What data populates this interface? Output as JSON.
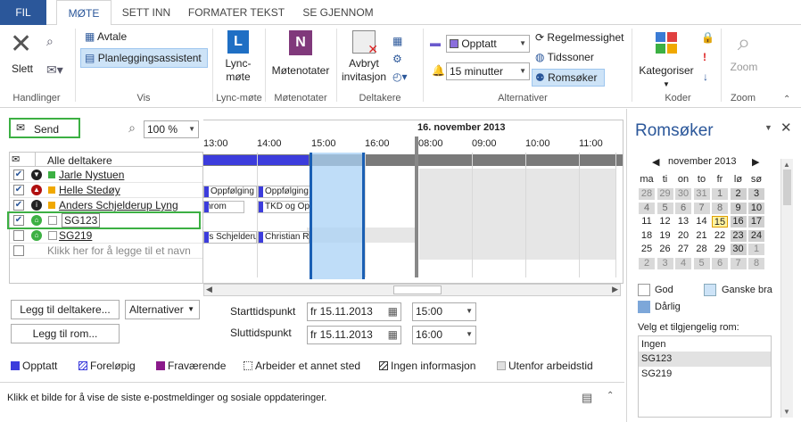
{
  "tabs": [
    {
      "label": "FIL"
    },
    {
      "label": "MØTE"
    },
    {
      "label": "SETT INN"
    },
    {
      "label": "FORMATER TEKST"
    },
    {
      "label": "SE GJENNOM"
    }
  ],
  "ribbon": {
    "slett": "Slett",
    "avtale": "Avtale",
    "planlegging": "Planleggingsassistent",
    "lync": "Lync-\nmøte",
    "motenotater": "Møtenotater",
    "avbryt1": "Avbryt",
    "avbryt2": "invitasjon",
    "status_combo": "Opptatt",
    "reminder_combo": "15 minutter",
    "regelmessighet": "Regelmessighet",
    "tidssoner": "Tidssoner",
    "romsoker": "Romsøker",
    "kategoriser": "Kategoriser",
    "zoom": "Zoom",
    "groups": [
      "Handlinger",
      "Vis",
      "Lync-møte",
      "Møtenotater",
      "Deltakere",
      "Alternativer",
      "Koder",
      "Zoom"
    ]
  },
  "toolbar": {
    "send": "Send",
    "zoom_value": "100 %"
  },
  "schedule": {
    "date": "16. november 2013",
    "times": [
      "13:00",
      "14:00",
      "15:00",
      "16:00",
      "08:00",
      "09:00",
      "10:00",
      "11:00"
    ],
    "all_attendees": "Alle deltakere",
    "attendees": [
      {
        "name": "Jarle Nystuen",
        "color": "#3cb043"
      },
      {
        "name": "Helle Stedøy",
        "color": "#f0a800"
      },
      {
        "name": "Anders Schjelderup Lyng",
        "color": "#f0a800"
      },
      {
        "name": "SG123",
        "color": ""
      },
      {
        "name": "SG219",
        "color": ""
      }
    ],
    "add_placeholder": "Klikk her for å legge til et navn",
    "busy": {
      "helle_a": "Oppfølging a",
      "helle_b": "Oppfølging a",
      "anders_a": "nrom",
      "anders_b": "TKD og Oper",
      "sg219_a": "rs Schjelderup L",
      "sg219_b": "Christian Ran"
    }
  },
  "buttons": {
    "legg_deltakere": "Legg til deltakere...",
    "alternativer": "Alternativer",
    "legg_rom": "Legg til rom..."
  },
  "times": {
    "start_label": "Starttidspunkt",
    "end_label": "Sluttidspunkt",
    "start_date": "fr 15.11.2013",
    "start_time": "15:00",
    "end_date": "fr 15.11.2013",
    "end_time": "16:00"
  },
  "legend": [
    "Opptatt",
    "Foreløpig",
    "Fraværende",
    "Arbeider et annet sted",
    "Ingen informasjon",
    "Utenfor arbeidstid"
  ],
  "status_bar": "Klikk et bilde for å vise de siste e-postmeldinger og sosiale oppdateringer.",
  "room_finder": {
    "title": "Romsøker",
    "month": "november 2013",
    "weekdays": [
      "ma",
      "ti",
      "on",
      "to",
      "fr",
      "lø",
      "sø"
    ],
    "weeks": [
      [
        "28",
        "29",
        "30",
        "31",
        "1",
        "2",
        "3"
      ],
      [
        "4",
        "5",
        "6",
        "7",
        "8",
        "9",
        "10"
      ],
      [
        "11",
        "12",
        "13",
        "14",
        "15",
        "16",
        "17"
      ],
      [
        "18",
        "19",
        "20",
        "21",
        "22",
        "23",
        "24"
      ],
      [
        "25",
        "26",
        "27",
        "28",
        "29",
        "30",
        "1"
      ],
      [
        "2",
        "3",
        "4",
        "5",
        "6",
        "7",
        "8"
      ]
    ],
    "good": "God",
    "fair": "Ganske bra",
    "poor": "Dårlig",
    "choose_room": "Velg et tilgjengelig rom:",
    "rooms": [
      "Ingen",
      "SG123",
      "SG219"
    ]
  }
}
